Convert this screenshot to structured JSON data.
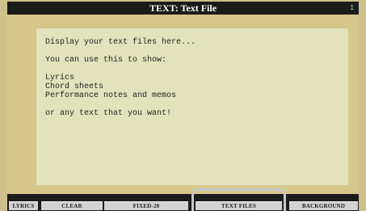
{
  "title_bar": {
    "title": "TEXT: Text File",
    "page_number": "1"
  },
  "text_area": {
    "lines": [
      "Display your text files here...",
      "",
      "You can use this to show:",
      "",
      "Lyrics",
      "Chord sheets",
      "Performance notes and memos",
      "",
      "or any text that you want!"
    ]
  },
  "tabs": [
    {
      "label": "LYRICS"
    },
    {
      "label": "CLEAR"
    },
    {
      "label": "FIXED-20"
    },
    {
      "label": "TEXT FILES",
      "selected": true
    },
    {
      "label": "BACKGROUND"
    }
  ],
  "colors": {
    "frame": "#cdc08a",
    "text_area": "#e2e2bd",
    "title_bar": "#1b1b1b",
    "tab": "#d2d2d2"
  }
}
